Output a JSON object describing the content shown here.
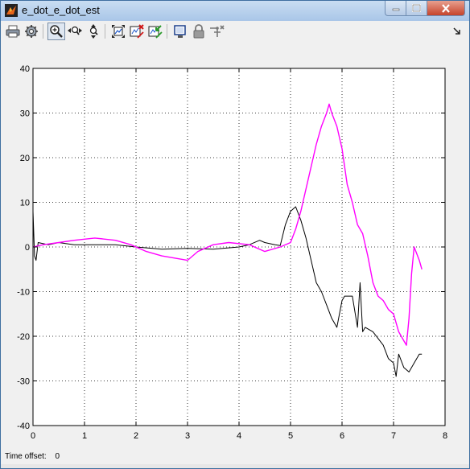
{
  "window": {
    "title": "e_dot_e_dot_est",
    "buttons": [
      "minimize",
      "maximize",
      "close"
    ]
  },
  "toolbar": {
    "items": [
      {
        "icon": "print-icon",
        "label": "Print"
      },
      {
        "icon": "parameters-icon",
        "label": "Parameters"
      },
      {
        "icon": "zoom-icon",
        "label": "Zoom"
      },
      {
        "icon": "zoom-x-icon",
        "label": "Zoom X-axis"
      },
      {
        "icon": "zoom-y-icon",
        "label": "Zoom Y-axis"
      },
      {
        "icon": "autoscale-icon",
        "label": "Autoscale"
      },
      {
        "icon": "save-axes-icon",
        "label": "Save axes settings"
      },
      {
        "icon": "restore-axes-icon",
        "label": "Restore saved axes settings"
      },
      {
        "icon": "floating-scope-icon",
        "label": "Floating scope"
      },
      {
        "icon": "lock-icon",
        "label": "Lock axes selection"
      },
      {
        "icon": "signal-selector-icon",
        "label": "Signal selection"
      },
      {
        "icon": "dock-arrow-icon",
        "label": "Dock"
      }
    ]
  },
  "status": {
    "time_offset_label": "Time offset:",
    "time_offset_value": "0"
  },
  "colors": {
    "series_black": "#000000",
    "series_magenta": "#ff00ff"
  },
  "chart_data": {
    "type": "line",
    "title": "",
    "xlabel": "",
    "ylabel": "",
    "xlim": [
      0,
      8
    ],
    "ylim": [
      -40,
      40
    ],
    "xticks": [
      "0",
      "1",
      "2",
      "3",
      "4",
      "5",
      "6",
      "7",
      "8"
    ],
    "yticks": [
      "40",
      "30",
      "20",
      "10",
      "0",
      "-10",
      "-20",
      "-30",
      "-40"
    ],
    "grid": true,
    "series": [
      {
        "color": "#000000",
        "x": [
          0,
          0.03,
          0.06,
          0.1,
          0.3,
          0.5,
          0.8,
          1.2,
          1.6,
          2.0,
          2.5,
          3.0,
          3.5,
          4.0,
          4.2,
          4.4,
          4.5,
          4.7,
          4.8,
          4.9,
          5.0,
          5.1,
          5.2,
          5.3,
          5.4,
          5.5,
          5.6,
          5.7,
          5.8,
          5.9,
          6.0,
          6.05,
          6.2,
          6.3,
          6.35,
          6.4,
          6.45,
          6.6,
          6.8,
          6.9,
          7.0,
          7.05,
          7.1,
          7.2,
          7.3,
          7.4,
          7.5,
          7.55
        ],
        "y": [
          8,
          -2,
          -3,
          1,
          0.5,
          1,
          0.5,
          0.5,
          0.5,
          0,
          -0.5,
          -0.3,
          -0.5,
          0,
          0.5,
          1.5,
          1,
          0.5,
          0.3,
          5,
          8,
          9,
          6,
          2,
          -3,
          -8,
          -10,
          -13,
          -16,
          -18,
          -12,
          -11,
          -11,
          -18,
          -8,
          -19,
          -18,
          -19,
          -22,
          -25,
          -26,
          -29,
          -24,
          -27,
          -28,
          -26,
          -24,
          -24
        ]
      },
      {
        "color": "#ff00ff",
        "x": [
          0,
          0.2,
          0.5,
          0.8,
          1.2,
          1.6,
          1.9,
          2.2,
          2.5,
          3.0,
          3.2,
          3.5,
          3.8,
          4.2,
          4.5,
          4.8,
          5.0,
          5.1,
          5.2,
          5.3,
          5.4,
          5.5,
          5.6,
          5.7,
          5.75,
          5.8,
          5.9,
          6.0,
          6.1,
          6.2,
          6.3,
          6.4,
          6.5,
          6.6,
          6.7,
          6.8,
          6.9,
          7.0,
          7.1,
          7.2,
          7.25,
          7.3,
          7.35,
          7.4,
          7.5,
          7.55
        ],
        "y": [
          0,
          0.5,
          1,
          1.5,
          2,
          1.5,
          0.5,
          -1,
          -2,
          -3,
          -1,
          0.5,
          1,
          0.5,
          -1,
          0,
          1,
          4,
          8,
          13,
          18,
          23,
          27,
          30,
          32,
          30,
          27,
          22,
          14,
          10,
          5,
          3,
          -2,
          -8,
          -11,
          -12,
          -14,
          -15,
          -19,
          -21,
          -22,
          -16,
          -6,
          0,
          -3,
          -5
        ]
      }
    ]
  }
}
